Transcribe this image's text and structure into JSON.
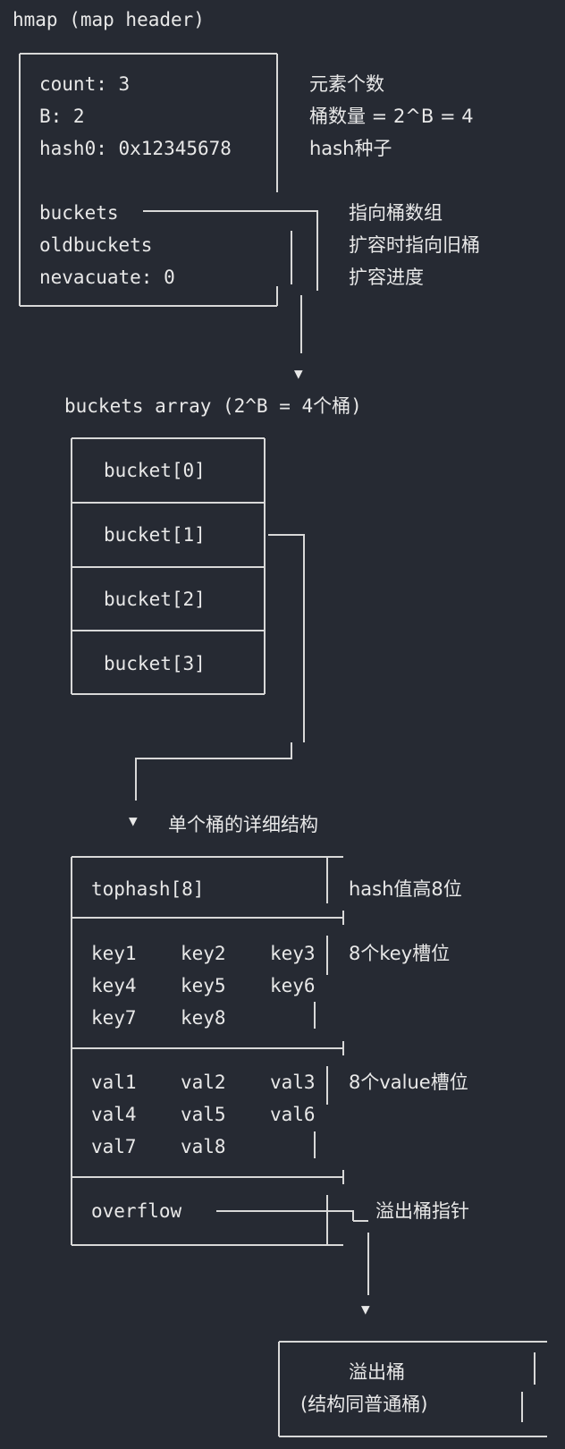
{
  "hmap": {
    "title": "hmap (map header)",
    "fields": [
      {
        "label": "count: 3",
        "note": "元素个数"
      },
      {
        "label": "B: 2",
        "note": "桶数量 = 2^B = 4"
      },
      {
        "label": "hash0: 0x12345678",
        "note": "hash种子"
      },
      {
        "label": "buckets",
        "note": "指向桶数组"
      },
      {
        "label": "oldbuckets",
        "note": "扩容时指向旧桶"
      },
      {
        "label": "nevacuate: 0",
        "note": "扩容进度"
      }
    ]
  },
  "buckets_array": {
    "title": "buckets array (2^B = 4个桶)",
    "items": [
      "bucket[0]",
      "bucket[1]",
      "bucket[2]",
      "bucket[3]"
    ]
  },
  "bucket_detail": {
    "title": "单个桶的详细结构",
    "tophash": {
      "label": "tophash[8]",
      "note": "hash值高8位"
    },
    "keys": {
      "rows": [
        [
          "key1",
          "key2",
          "key3"
        ],
        [
          "key4",
          "key5",
          "key6"
        ],
        [
          "key7",
          "key8"
        ]
      ],
      "note": "8个key槽位"
    },
    "values": {
      "rows": [
        [
          "val1",
          "val2",
          "val3"
        ],
        [
          "val4",
          "val5",
          "val6"
        ],
        [
          "val7",
          "val8"
        ]
      ],
      "note": "8个value槽位"
    },
    "overflow": {
      "label": "overflow",
      "note": "溢出桶指针"
    }
  },
  "overflow_bucket": {
    "title": "溢出桶",
    "subtitle": "(结构同普通桶)"
  }
}
